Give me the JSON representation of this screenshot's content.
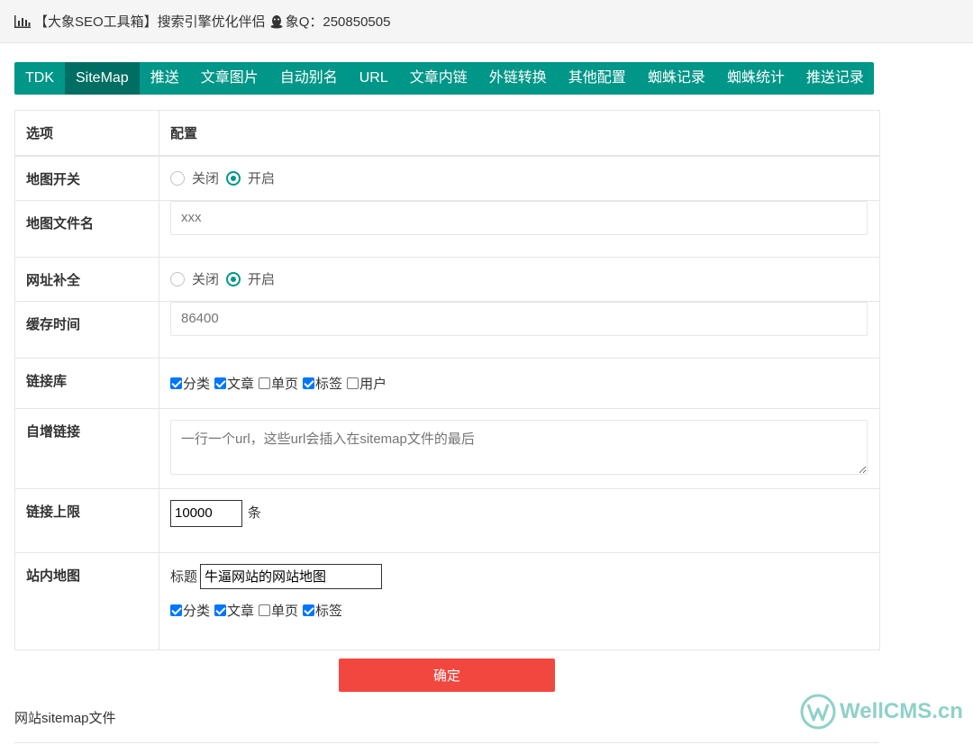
{
  "header": {
    "title": "【大象SEO工具箱】搜索引擎优化伴侣",
    "contact": "象Q：250850505",
    "chart_icon": "bar-chart-icon",
    "qq_icon": "qq-penguin-icon"
  },
  "tabs": [
    {
      "label": "TDK"
    },
    {
      "label": "SiteMap",
      "active": true
    },
    {
      "label": "推送"
    },
    {
      "label": "文章图片"
    },
    {
      "label": "自动别名"
    },
    {
      "label": "URL"
    },
    {
      "label": "文章内链"
    },
    {
      "label": "外链转换"
    },
    {
      "label": "其他配置"
    },
    {
      "label": "蜘蛛记录"
    },
    {
      "label": "蜘蛛统计"
    },
    {
      "label": "推送记录"
    }
  ],
  "table": {
    "col_option": "选项",
    "col_config": "配置",
    "map_switch": {
      "label": "地图开关",
      "off": "关闭",
      "on": "开启",
      "selected": "on"
    },
    "map_filename": {
      "label": "地图文件名",
      "placeholder": "xxx"
    },
    "url_complete": {
      "label": "网址补全",
      "off": "关闭",
      "on": "开启",
      "selected": "on"
    },
    "cache_time": {
      "label": "缓存时间",
      "placeholder": "86400"
    },
    "link_lib": {
      "label": "链接库",
      "options": [
        {
          "label": "分类",
          "checked": true
        },
        {
          "label": "文章",
          "checked": true
        },
        {
          "label": "单页",
          "checked": false
        },
        {
          "label": "标签",
          "checked": true
        },
        {
          "label": "用户",
          "checked": false
        }
      ]
    },
    "custom_links": {
      "label": "自增链接",
      "placeholder": "一行一个url，这些url会插入在sitemap文件的最后"
    },
    "link_limit": {
      "label": "链接上限",
      "value": "10000",
      "unit": "条"
    },
    "site_map": {
      "label": "站内地图",
      "title_label": "标题",
      "title_value": "牛逼网站的网站地图",
      "options": [
        {
          "label": "分类",
          "checked": true
        },
        {
          "label": "文章",
          "checked": true
        },
        {
          "label": "单页",
          "checked": false
        },
        {
          "label": "标签",
          "checked": true
        }
      ]
    }
  },
  "submit_label": "确定",
  "footer_text": "网站sitemap文件",
  "watermark": "WellCMS.cn",
  "colors": {
    "accent": "#009688",
    "accent_active": "#006e63",
    "submit": "#f2473f"
  }
}
